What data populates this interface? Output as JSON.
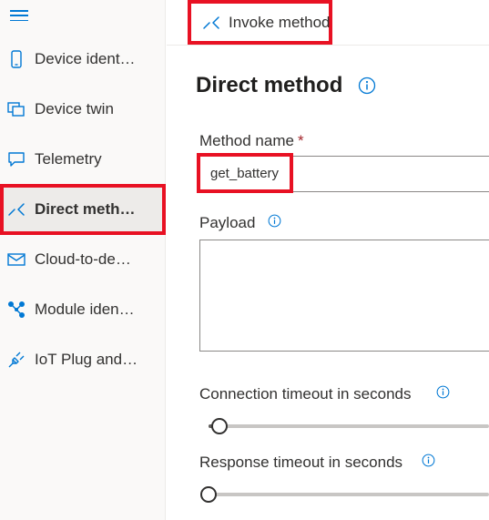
{
  "sidebar": {
    "items": [
      {
        "label": "Device ident…",
        "icon": "device-identity-icon"
      },
      {
        "label": "Device twin",
        "icon": "device-twin-icon"
      },
      {
        "label": "Telemetry",
        "icon": "telemetry-icon"
      },
      {
        "label": "Direct meth…",
        "icon": "direct-method-icon",
        "active": true
      },
      {
        "label": "Cloud-to-de…",
        "icon": "cloud-to-device-icon"
      },
      {
        "label": "Module iden…",
        "icon": "module-identity-icon"
      },
      {
        "label": "IoT Plug and…",
        "icon": "plug-icon"
      }
    ]
  },
  "toolbar": {
    "invoke_label": "Invoke method"
  },
  "main": {
    "title": "Direct method",
    "method_name": {
      "label": "Method name",
      "required_mark": "*",
      "value": "get_battery"
    },
    "payload": {
      "label": "Payload",
      "value": ""
    },
    "connection_timeout": {
      "label": "Connection timeout in seconds",
      "value_fraction": 0.04
    },
    "response_timeout": {
      "label": "Response timeout in seconds",
      "value_fraction": 0.0
    }
  },
  "colors": {
    "accent": "#0078d4",
    "highlight": "#e81123"
  }
}
